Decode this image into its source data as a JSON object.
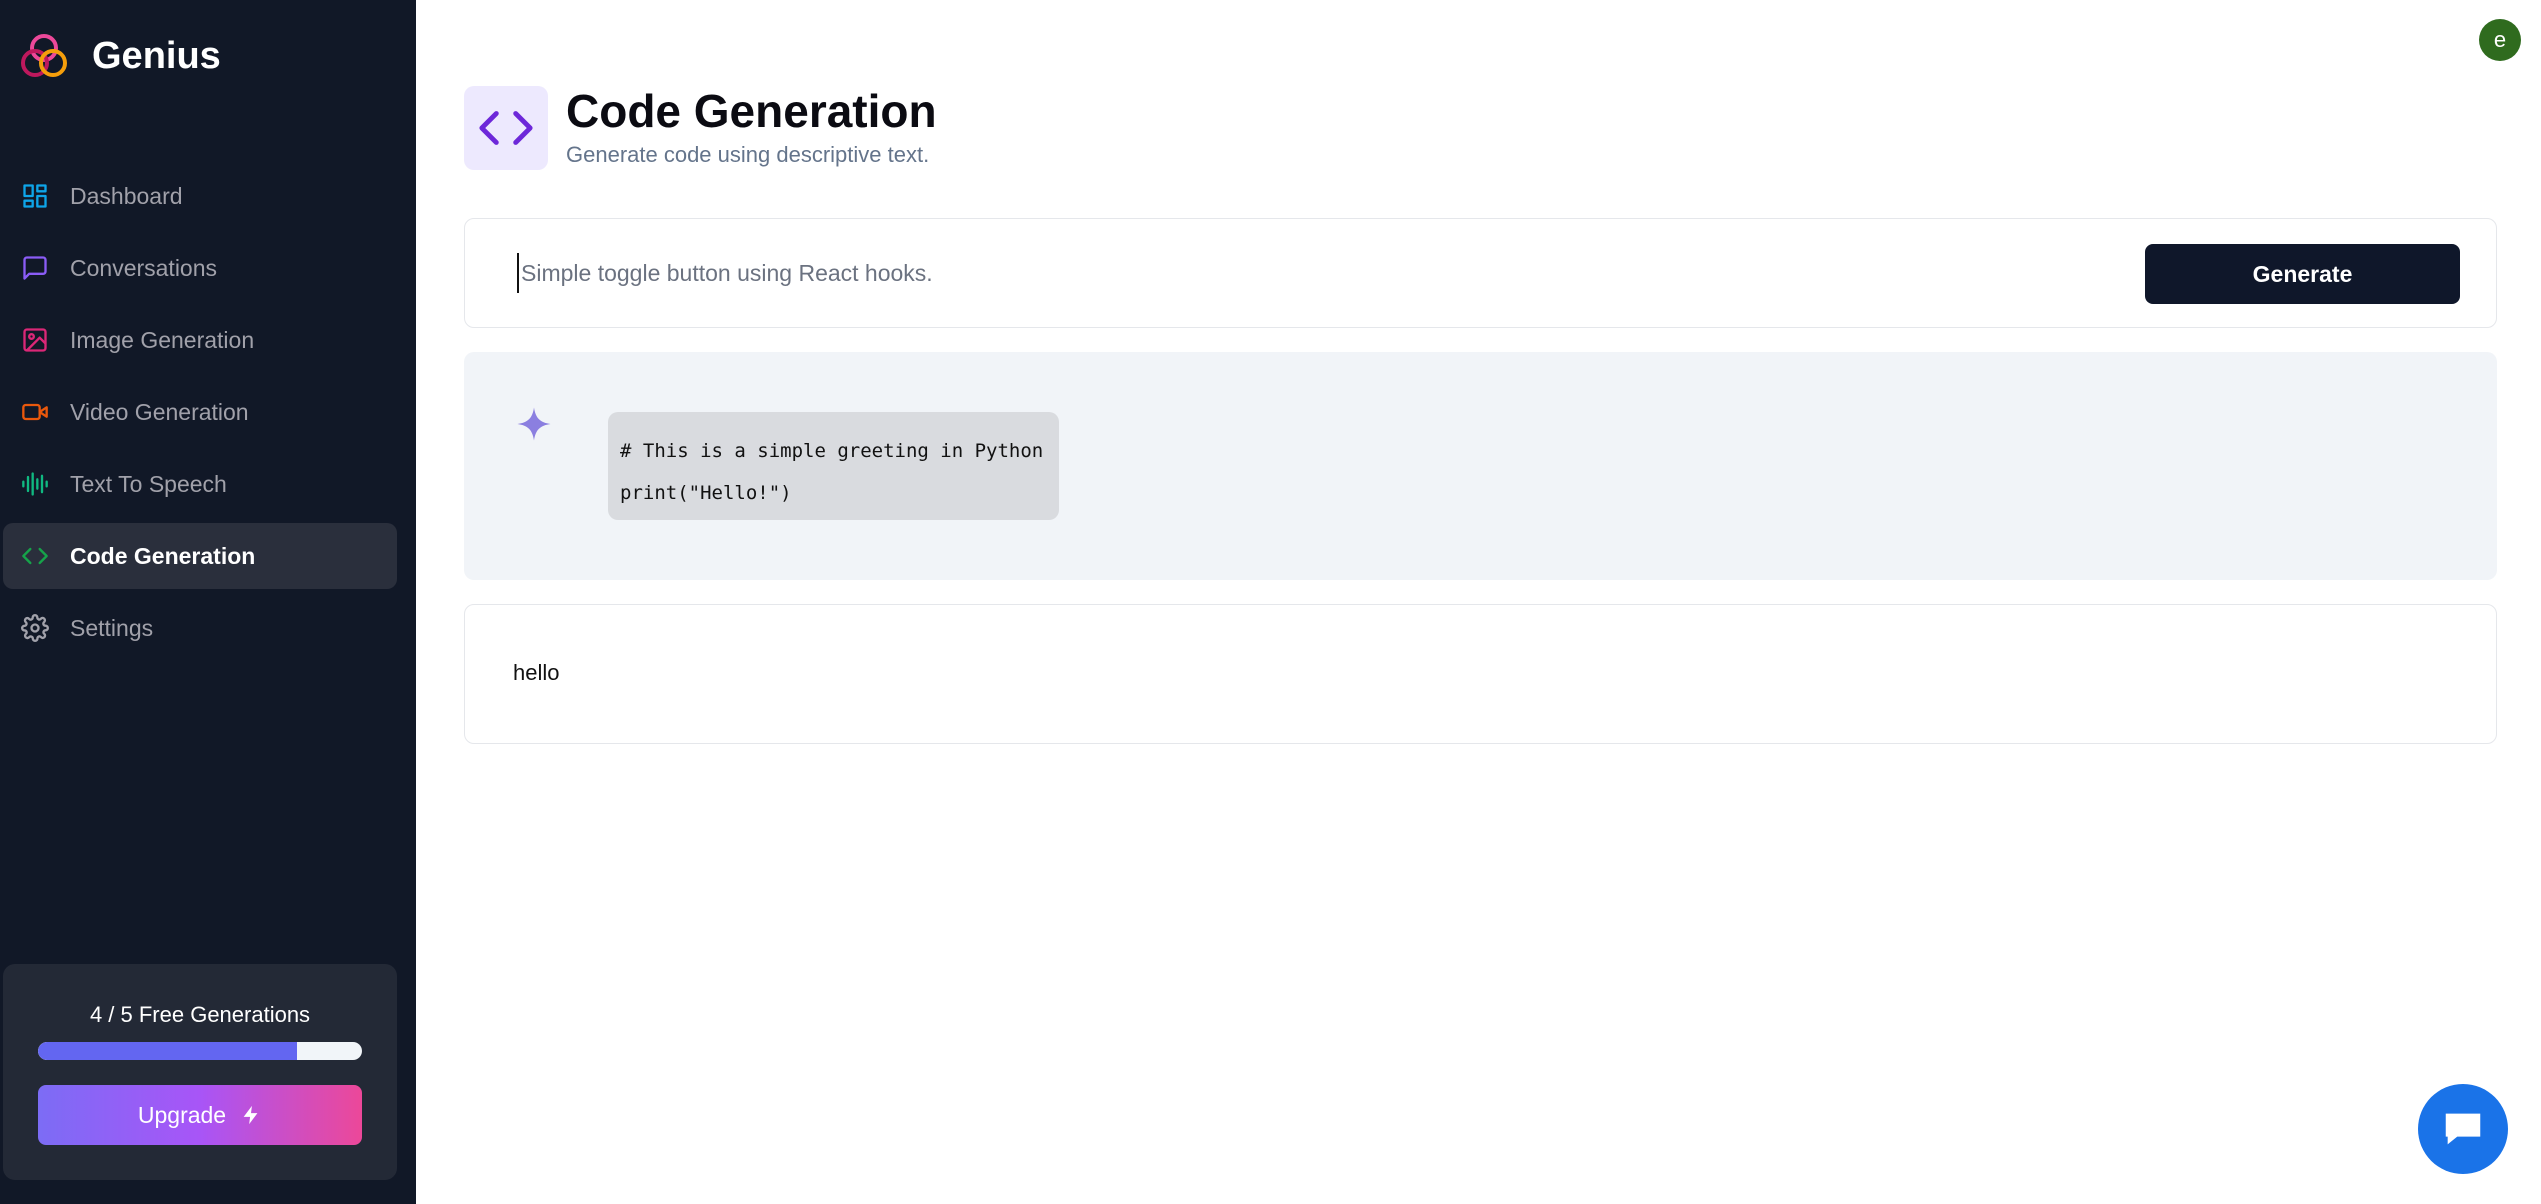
{
  "brand": {
    "name": "Genius",
    "logo_icon": "genius-logo-icon"
  },
  "sidebar": {
    "items": [
      {
        "label": "Dashboard",
        "icon": "dashboard-icon",
        "color": "#0ea5e9",
        "active": false
      },
      {
        "label": "Conversations",
        "icon": "message-square-icon",
        "color": "#8b5cf6",
        "active": false
      },
      {
        "label": "Image Generation",
        "icon": "image-icon",
        "color": "#db2777",
        "active": false
      },
      {
        "label": "Video Generation",
        "icon": "video-icon",
        "color": "#ea580c",
        "active": false
      },
      {
        "label": "Text To Speech",
        "icon": "audio-waveform-icon",
        "color": "#10b981",
        "active": false
      },
      {
        "label": "Code Generation",
        "icon": "code-icon",
        "color": "#16a34a",
        "active": true
      },
      {
        "label": "Settings",
        "icon": "settings-icon",
        "color": "#a1a1aa",
        "active": false
      }
    ]
  },
  "usage": {
    "label": "4 / 5 Free Generations",
    "used": 4,
    "limit": 5,
    "upgrade_label": "Upgrade",
    "upgrade_icon": "zap-icon"
  },
  "header": {
    "avatar_letter": "e"
  },
  "page": {
    "title": "Code Generation",
    "subtitle": "Generate code using descriptive text.",
    "icon": "code-icon",
    "icon_color": "#6d28d9"
  },
  "prompt": {
    "value": "",
    "placeholder": "Simple toggle button using React hooks.",
    "generate_label": "Generate"
  },
  "messages": [
    {
      "role": "bot",
      "icon": "sparkle-icon",
      "code_lines": [
        "# This is a simple greeting in Python",
        "print(\"Hello!\")"
      ]
    },
    {
      "role": "user",
      "text": "hello"
    }
  ],
  "chat_widget": {
    "icon": "chat-bubble-icon",
    "color": "#1a73e8"
  }
}
